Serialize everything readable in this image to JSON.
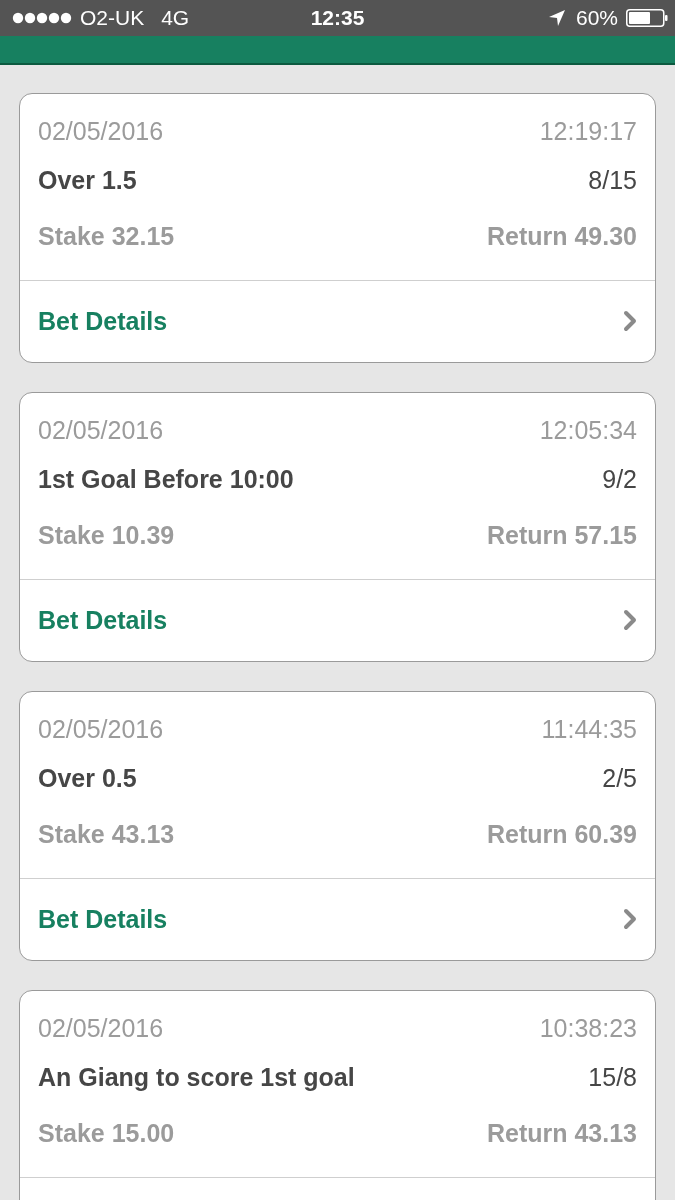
{
  "status_bar": {
    "carrier": "O2-UK",
    "network": "4G",
    "time": "12:35",
    "battery": "60%"
  },
  "bets": [
    {
      "date": "02/05/2016",
      "time": "12:19:17",
      "selection": "Over 1.5",
      "odds": "8/15",
      "stake": "Stake 32.15",
      "return": "Return 49.30",
      "details_link": "Bet Details"
    },
    {
      "date": "02/05/2016",
      "time": "12:05:34",
      "selection": "1st Goal Before 10:00",
      "odds": "9/2",
      "stake": "Stake 10.39",
      "return": "Return 57.15",
      "details_link": "Bet Details"
    },
    {
      "date": "02/05/2016",
      "time": "11:44:35",
      "selection": "Over 0.5",
      "odds": "2/5",
      "stake": "Stake 43.13",
      "return": "Return 60.39",
      "details_link": "Bet Details"
    },
    {
      "date": "02/05/2016",
      "time": "10:38:23",
      "selection": "An Giang to score 1st goal",
      "odds": "15/8",
      "stake": "Stake 15.00",
      "return": "Return 43.13"
    }
  ]
}
